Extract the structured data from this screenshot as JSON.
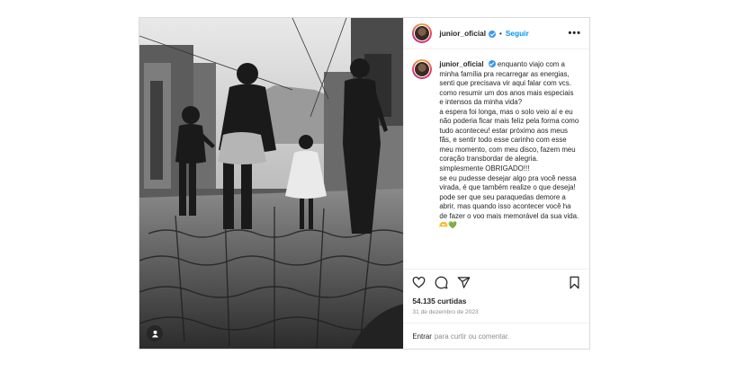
{
  "post": {
    "username": "junior_oficial",
    "follow_label": "Seguir",
    "separator": "•",
    "more_label": "•••",
    "caption": "enquanto viajo com a minha família pra recarregar as energias, senti que precisava vir aqui falar com vcs.\ncomo resumir um dos anos mais especiais e intensos da minha vida?\na espera foi longa, mas o solo veio aí e eu não poderia ficar mais feliz pela forma como tudo aconteceu! estar próximo aos meus fãs, e sentir todo esse carinho com esse meu momento, com meu disco, fazem meu coração transbordar de alegria. simplesmente OBRIGADO!!!\nse eu pudesse desejar algo pra você nessa virada, é que também realize o que deseja! pode ser que seu paraquedas demore a abrir, mas quando isso acontecer você ha de fazer o voo mais memorável da sua vida. 🫶💚",
    "likes": "54.135 curtidas",
    "date": "31 de dezembro de 2023",
    "comment_action": "Entrar",
    "comment_prompt": "para curtir ou comentar."
  },
  "icons": {
    "like": "heart-icon",
    "comment": "comment-icon",
    "share": "share-icon",
    "save": "bookmark-icon",
    "tag": "user-tag-icon"
  },
  "colors": {
    "follow": "#0095f6",
    "verified": "#3897f0",
    "secondary_text": "#8e8e8e"
  }
}
